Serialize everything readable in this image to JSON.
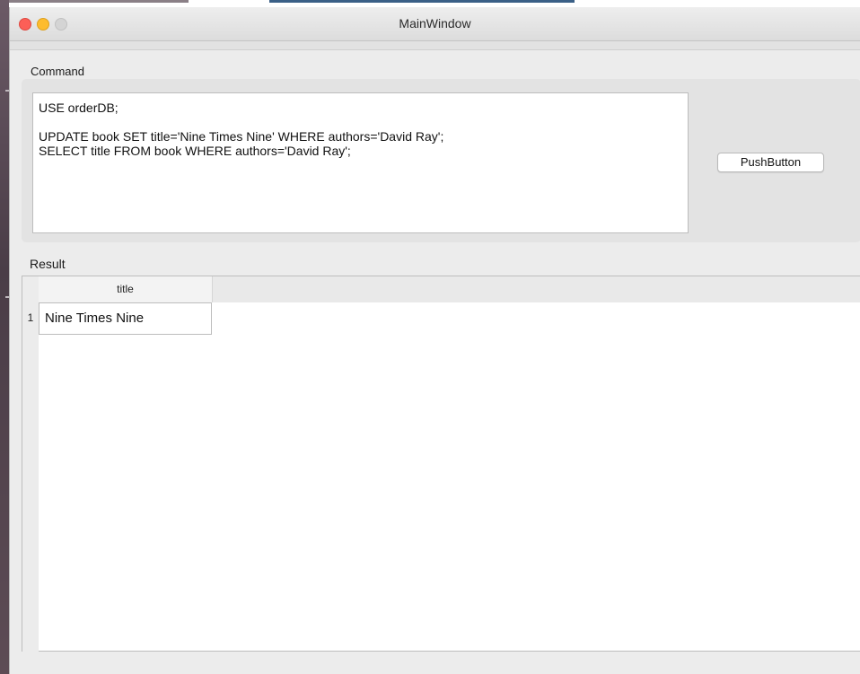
{
  "window": {
    "title": "MainWindow"
  },
  "command": {
    "group_label": "Command",
    "text": "USE orderDB;\n\nUPDATE book SET title='Nine Times Nine' WHERE authors='David Ray';\nSELECT title FROM book WHERE authors='David Ray';",
    "button_label": "PushButton"
  },
  "result": {
    "group_label": "Result",
    "columns": [
      "title"
    ],
    "rows": [
      {
        "number": "1",
        "cells": [
          "Nine Times Nine"
        ]
      }
    ]
  },
  "colors": {
    "close": "#fc5f57",
    "minimize": "#fdbc2e",
    "zoom": "#d4d4d4",
    "window_bg": "#ececec"
  }
}
